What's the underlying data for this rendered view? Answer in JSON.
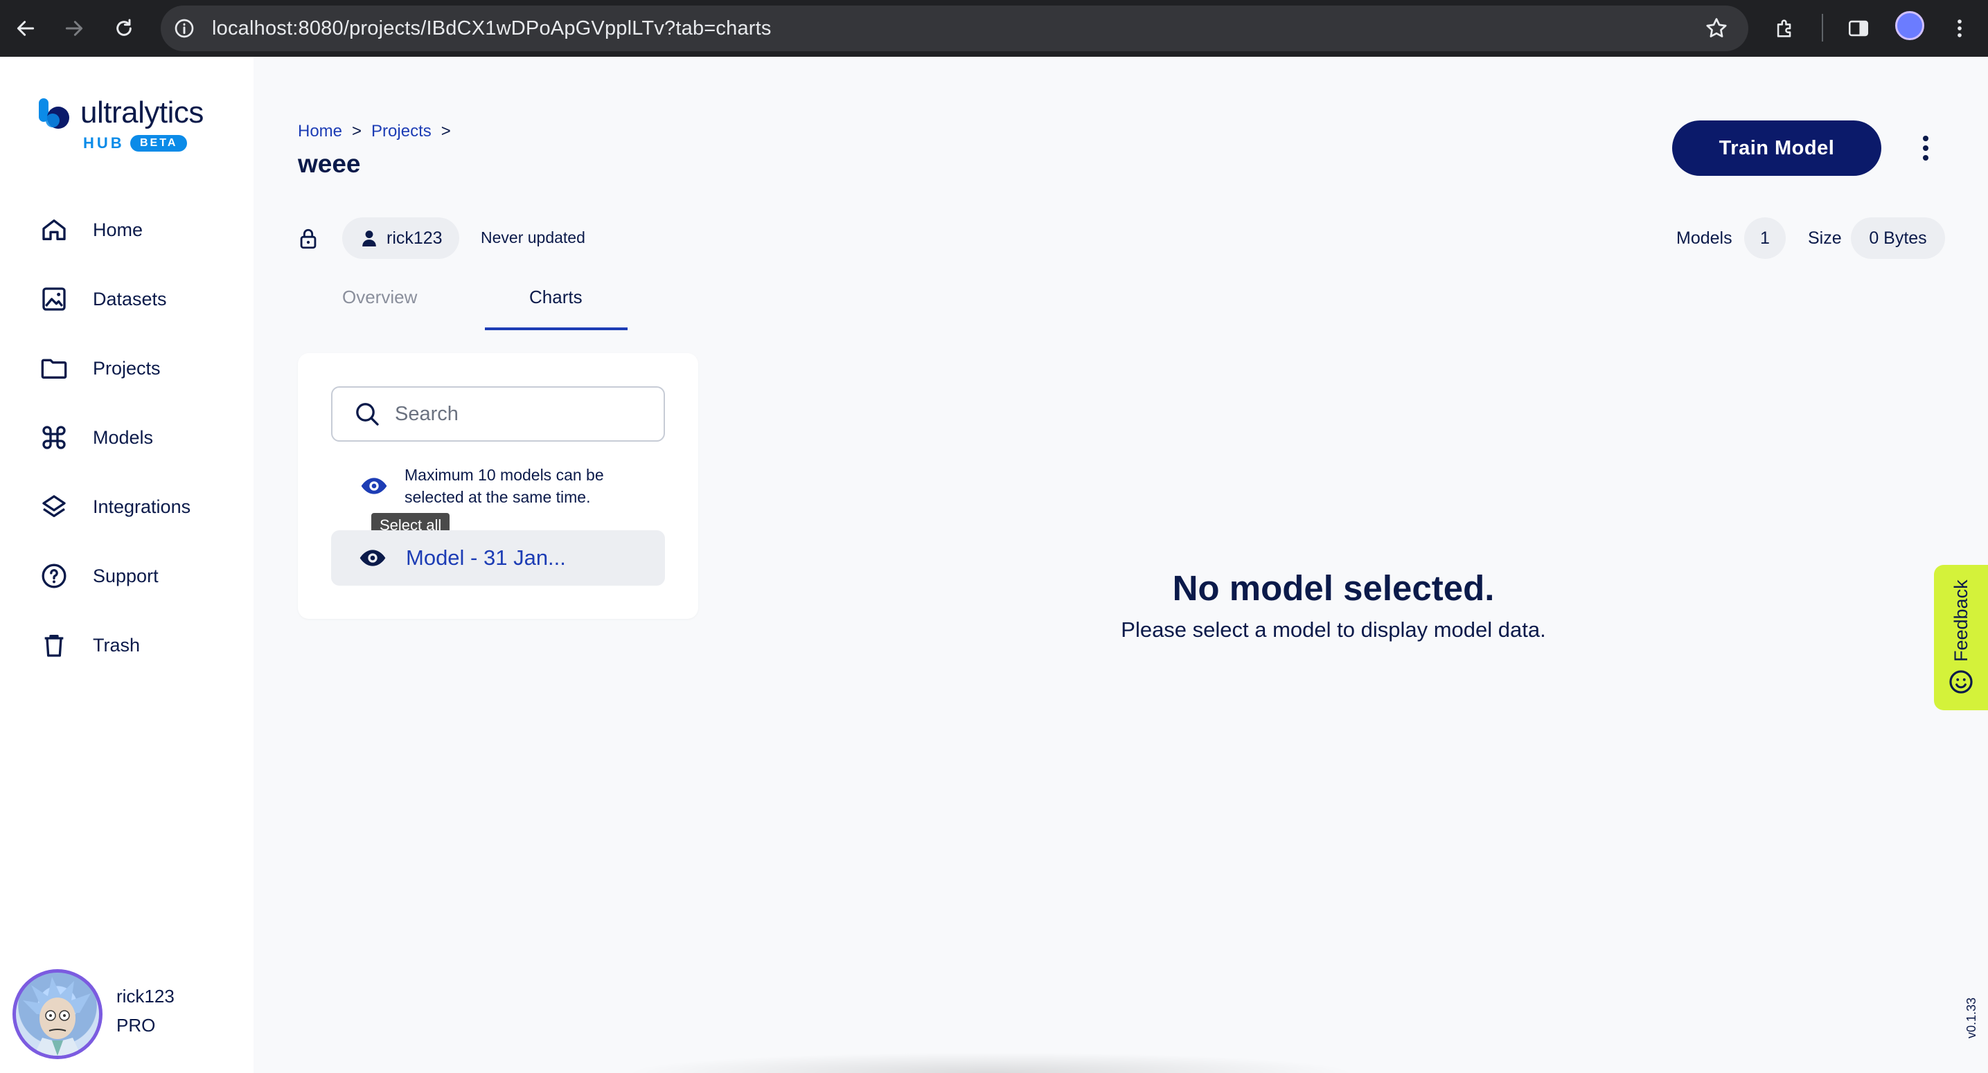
{
  "browser": {
    "url": "localhost:8080/projects/IBdCX1wDPoApGVpplLTv?tab=charts"
  },
  "brand": {
    "name": "ultralytics",
    "hub": "HUB",
    "beta": "BETA",
    "accent": "#0b8be8",
    "navy": "#0b1a4a"
  },
  "sidebar": {
    "items": [
      {
        "label": "Home",
        "icon": "home-icon"
      },
      {
        "label": "Datasets",
        "icon": "image-icon"
      },
      {
        "label": "Projects",
        "icon": "folder-icon"
      },
      {
        "label": "Models",
        "icon": "command-icon"
      },
      {
        "label": "Integrations",
        "icon": "layers-icon"
      },
      {
        "label": "Support",
        "icon": "help-circle-icon"
      },
      {
        "label": "Trash",
        "icon": "trash-icon"
      }
    ]
  },
  "user": {
    "name": "rick123",
    "plan": "PRO"
  },
  "breadcrumb": {
    "home": "Home",
    "sep1": ">",
    "projects": "Projects",
    "sep2": ">"
  },
  "project": {
    "title": "weee",
    "owner": "rick123",
    "updated": "Never updated",
    "models_label": "Models",
    "models_count": "1",
    "size_label": "Size",
    "size_value": "0 Bytes"
  },
  "actions": {
    "train_model": "Train Model"
  },
  "tabs": {
    "overview": "Overview",
    "charts": "Charts",
    "active": "Charts"
  },
  "panel": {
    "search_placeholder": "Search",
    "info": "Maximum 10 models can be selected at the same time.",
    "tooltip": "Select all",
    "models": [
      {
        "name": "Model - 31 Jan..."
      }
    ]
  },
  "empty_state": {
    "title": "No model selected.",
    "subtitle": "Please select a model to display model data."
  },
  "feedback": {
    "label": "Feedback",
    "color": "#d4f23a"
  },
  "version": "v0.1.33"
}
